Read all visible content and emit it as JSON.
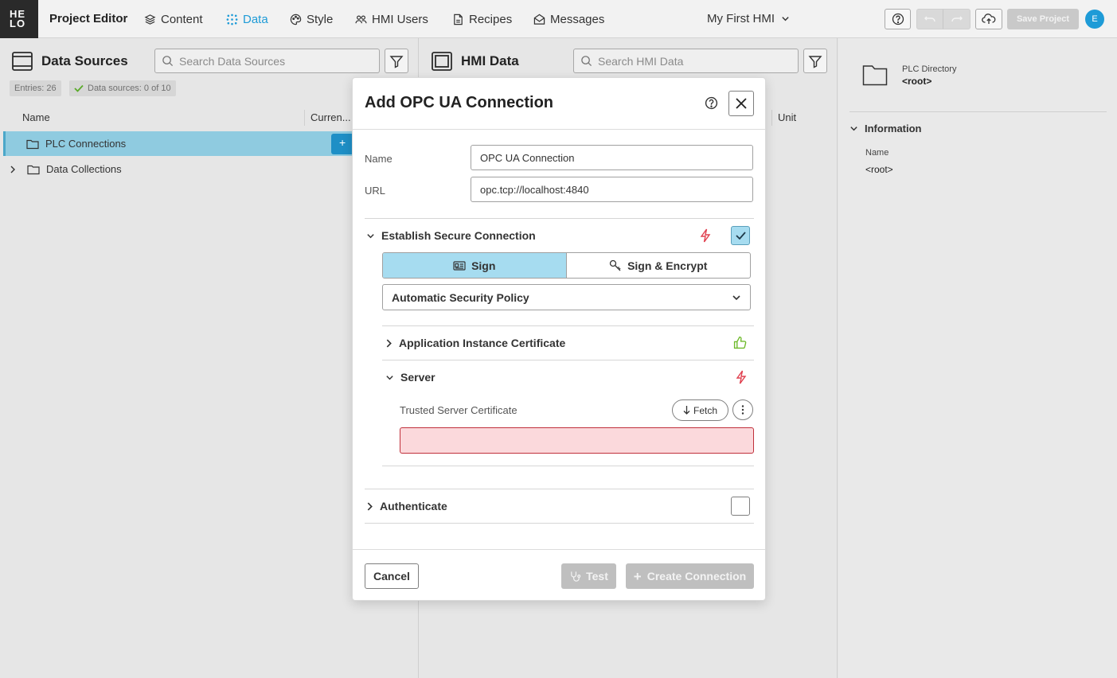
{
  "topbar": {
    "logo": "HE LO",
    "app_title": "Project Editor",
    "nav": [
      {
        "label": "Content",
        "icon": "layers-icon"
      },
      {
        "label": "Data",
        "icon": "data-dots-icon",
        "active": true
      },
      {
        "label": "Style",
        "icon": "palette-icon"
      },
      {
        "label": "HMI Users",
        "icon": "users-icon"
      },
      {
        "label": "Recipes",
        "icon": "recipe-icon"
      },
      {
        "label": "Messages",
        "icon": "envelope-icon"
      }
    ],
    "hmi_selector": "My First HMI",
    "save_label": "Save Project",
    "avatar_initial": "E"
  },
  "data_sources": {
    "title": "Data Sources",
    "search_placeholder": "Search Data Sources",
    "entries_badge": "Entries: 26",
    "sources_badge": "Data sources: 0 of 10",
    "col_name": "Name",
    "col_current": "Curren...",
    "rows": [
      "PLC Connections",
      "Data Collections"
    ]
  },
  "hmi_data": {
    "title": "HMI Data",
    "search_placeholder": "Search HMI Data",
    "col_unit": "Unit"
  },
  "details": {
    "dir_label": "PLC Directory",
    "dir_value": "<root>",
    "info_title": "Information",
    "name_label": "Name",
    "name_value": "<root>"
  },
  "modal": {
    "title": "Add OPC UA Connection",
    "name_label": "Name",
    "name_value": "OPC UA Connection",
    "url_label": "URL",
    "url_value": "opc.tcp://localhost:4840",
    "secure_title": "Establish Secure Connection",
    "sign_label": "Sign",
    "sign_encrypt_label": "Sign & Encrypt",
    "policy": "Automatic Security Policy",
    "app_cert_title": "Application Instance Certificate",
    "server_title": "Server",
    "trusted_cert_label": "Trusted Server Certificate",
    "fetch_label": "Fetch",
    "authenticate_title": "Authenticate",
    "cancel_label": "Cancel",
    "test_label": "Test",
    "create_label": "Create Connection"
  },
  "colors": {
    "accent": "#1e9bd7",
    "selected_row": "#8fcbe0",
    "warning": "#e0404f",
    "ok": "#6fba2c"
  }
}
